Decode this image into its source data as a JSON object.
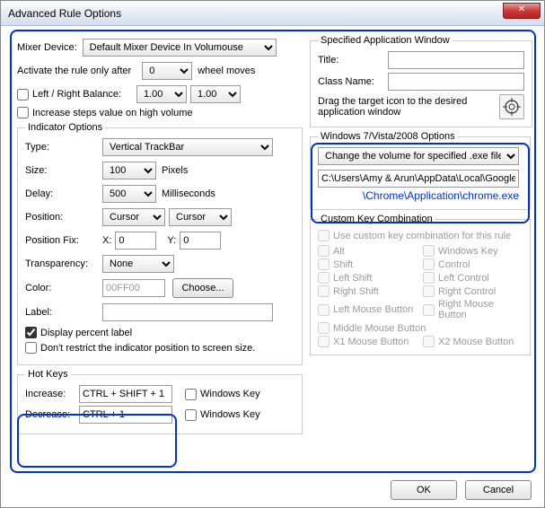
{
  "window": {
    "title": "Advanced Rule Options",
    "close_glyph": "✕"
  },
  "left": {
    "mixer_label": "Mixer Device:",
    "mixer_value": "Default Mixer Device In Volumouse",
    "activate_label_pre": "Activate the rule only after",
    "activate_value": "0",
    "activate_label_post": "wheel moves",
    "lr_balance_label": "Left / Right Balance:",
    "lr_balance_left": "1.00",
    "lr_balance_right": "1.00",
    "increase_steps_label": "Increase steps value on high volume"
  },
  "indicator": {
    "legend": "Indicator Options",
    "type_label": "Type:",
    "type_value": "Vertical TrackBar",
    "size_label": "Size:",
    "size_value": "100",
    "size_unit": "Pixels",
    "delay_label": "Delay:",
    "delay_value": "500",
    "delay_unit": "Milliseconds",
    "position_label": "Position:",
    "position_x": "Cursor",
    "position_y": "Cursor",
    "position_fix_label": "Position Fix:",
    "position_fix_xlabel": "X:",
    "position_fix_x": "0",
    "position_fix_ylabel": "Y:",
    "position_fix_y": "0",
    "transparency_label": "Transparency:",
    "transparency_value": "None",
    "color_label": "Color:",
    "color_value": "00FF00",
    "choose_btn": "Choose...",
    "label_label": "Label:",
    "label_value": "",
    "display_percent_label": "Display percent label",
    "dont_restrict_label": "Don't restrict the indicator position to screen size."
  },
  "hotkeys": {
    "legend": "Hot Keys",
    "increase_label": "Increase:",
    "increase_value": "CTRL + SHIFT + 1",
    "decrease_label": "Decrease:",
    "decrease_value": "CTRL + 1",
    "winkey_label": "Windows Key"
  },
  "spec_app": {
    "legend": "Specified Application Window",
    "title_label": "Title:",
    "title_value": "",
    "class_label": "Class Name:",
    "class_value": "",
    "drag_text": "Drag the target icon to the desired application window",
    "target_glyph": "⊕"
  },
  "win7": {
    "legend": "Windows 7/Vista/2008 Options",
    "mode_value": "Change the volume for specified .exe file",
    "path_value": "C:\\Users\\Amy & Arun\\AppData\\Local\\Google\\",
    "path_extra": "\\Chrome\\Application\\chrome.exe"
  },
  "custom": {
    "legend": "Custom Key Combination",
    "use_custom_label": "Use custom key combination for this rule",
    "keys": {
      "alt": "Alt",
      "winkey": "Windows Key",
      "shift": "Shift",
      "control": "Control",
      "lshift": "Left Shift",
      "lcontrol": "Left Control",
      "rshift": "Right Shift",
      "rcontrol": "Right Control",
      "lmb": "Left Mouse Button",
      "rmb": "Right Mouse Button",
      "mmb": "Middle Mouse Button",
      "x1": "X1 Mouse Button",
      "x2": "X2 Mouse Button"
    }
  },
  "buttons": {
    "ok": "OK",
    "cancel": "Cancel"
  }
}
